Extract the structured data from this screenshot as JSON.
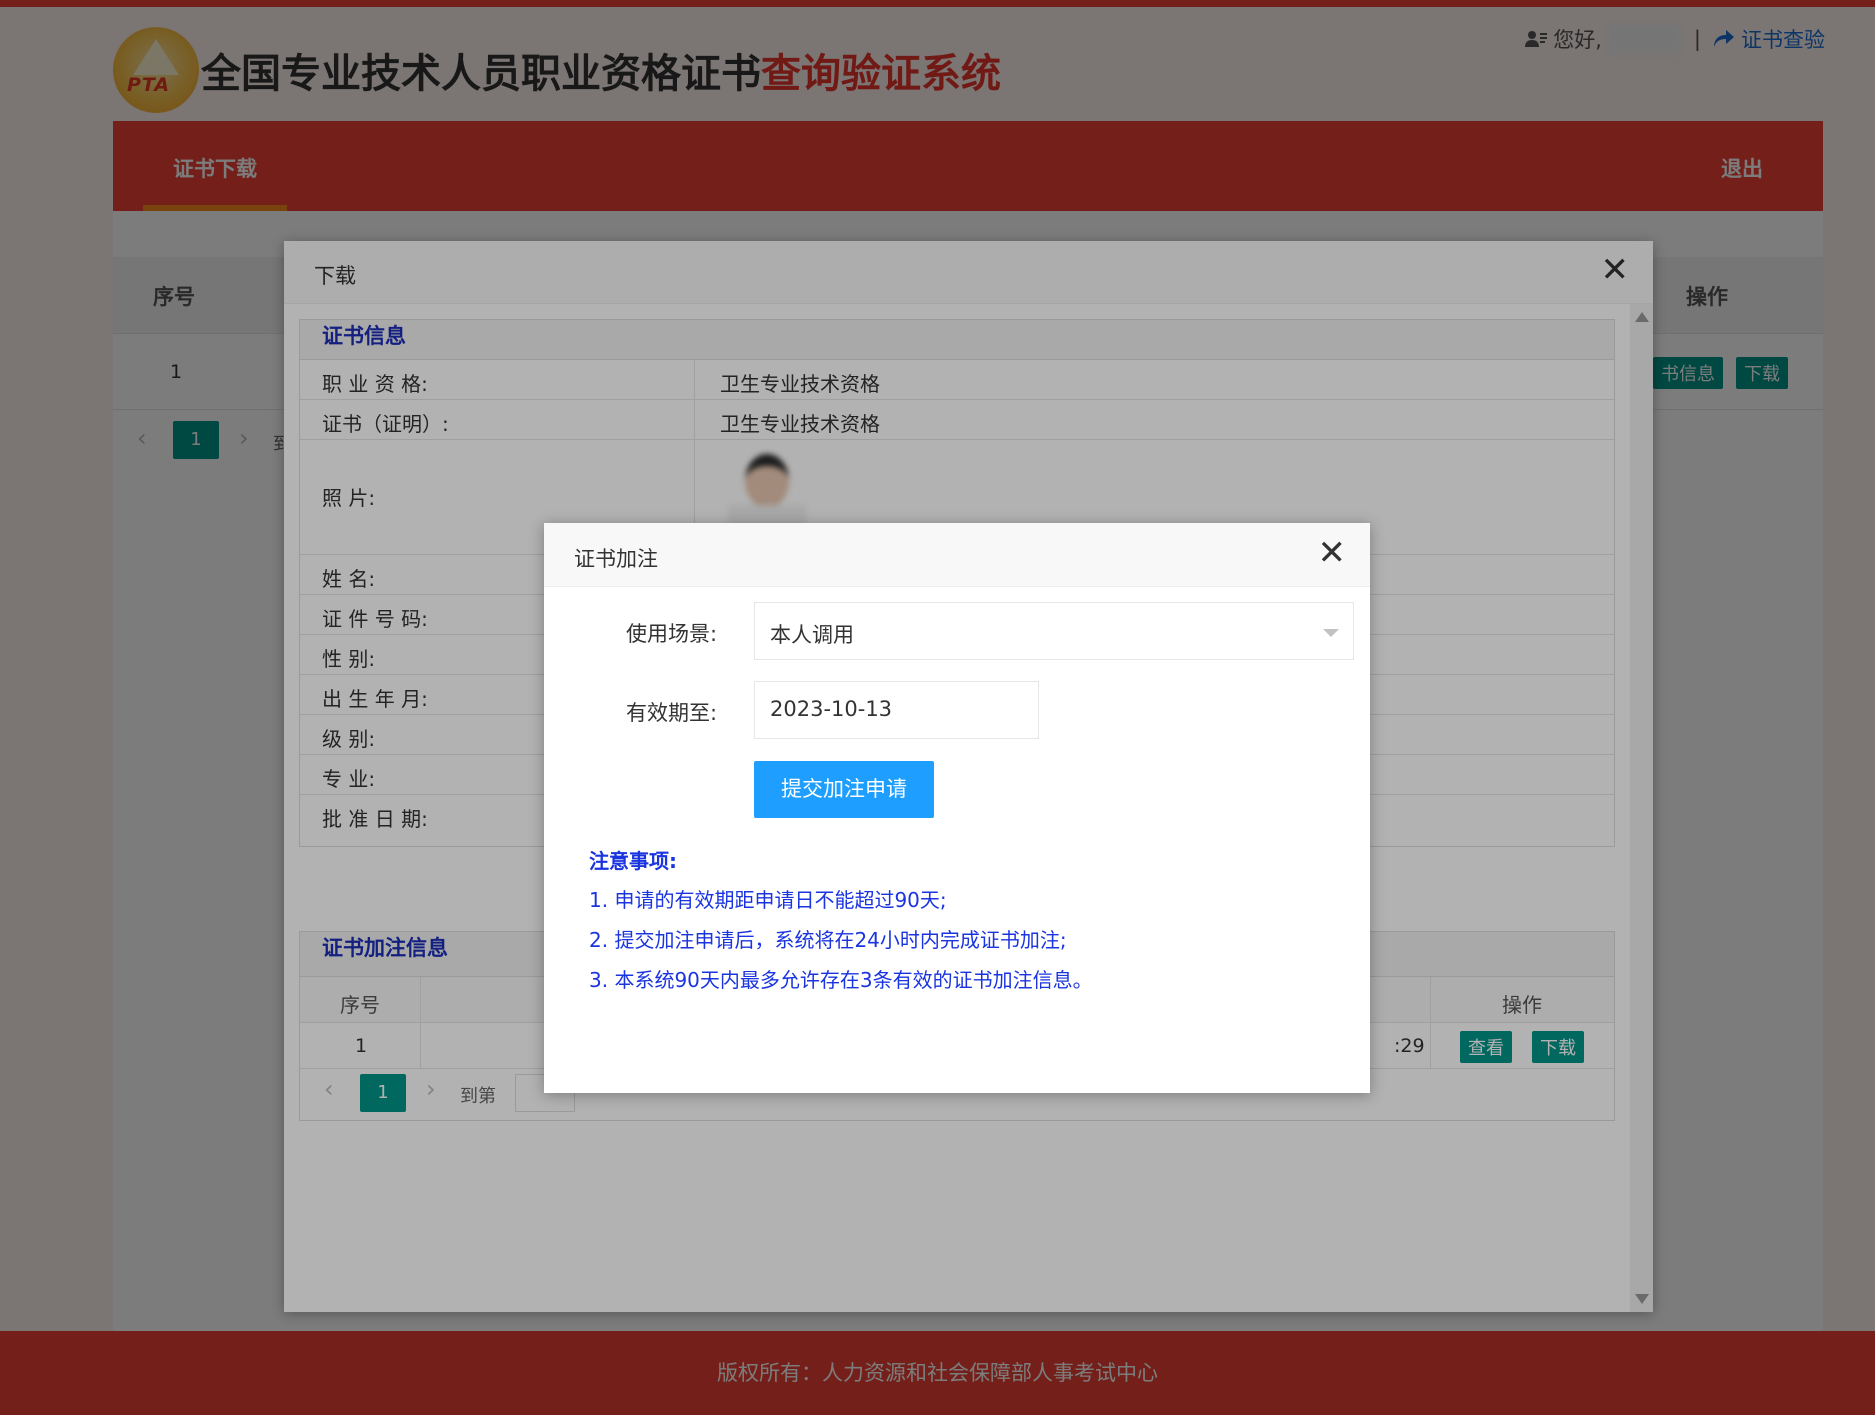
{
  "header": {
    "logo_text": "PTA",
    "title_main": "全国专业技术人员职业资格证书",
    "title_accent": "查询验证系统",
    "greeting": "您好,",
    "separator": "|",
    "verify_link": "证书查验"
  },
  "nav": {
    "tab_active": "证书下载",
    "logout": "退出"
  },
  "bg_table": {
    "col_index": "序号",
    "col_action": "操作",
    "row_index": "1",
    "btn_info": "书信息",
    "btn_download": "下载",
    "page_current": "1",
    "goto_partial": "到"
  },
  "download_dialog": {
    "title": "下载",
    "section_cert": "证书信息",
    "rows": [
      {
        "label": "职 业 资 格:",
        "value": "卫生专业技术资格"
      },
      {
        "label": "证书（证明）:",
        "value": "卫生专业技术资格"
      },
      {
        "label": "照          片:",
        "value": ""
      },
      {
        "label": "姓          名:",
        "value": ""
      },
      {
        "label": "证 件 号 码:",
        "value": ""
      },
      {
        "label": "性          别:",
        "value": ""
      },
      {
        "label": "出 生 年 月:",
        "value": ""
      },
      {
        "label": "级          别:",
        "value": ""
      },
      {
        "label": "专          业:",
        "value": ""
      },
      {
        "label": "批 准 日 期:",
        "value": ""
      }
    ],
    "section_note": "证书加注信息",
    "note_col_index": "序号",
    "note_col_action": "操作",
    "note_row_index": "1",
    "note_row_time_tail": ":29",
    "btn_view": "查看",
    "btn_download": "下载",
    "page_current": "1",
    "goto_label": "到第"
  },
  "annotate_dialog": {
    "title": "证书加注",
    "scene_label": "使用场景:",
    "scene_value": "本人调用",
    "valid_label": "有效期至:",
    "valid_value": "2023-10-13",
    "submit_label": "提交加注申请",
    "notice_title": "注意事项:",
    "notice_items": [
      "1. 申请的有效期距申请日不能超过90天;",
      "2. 提交加注申请后，系统将在24小时内完成证书加注;",
      "3. 本系统90天内最多允许存在3条有效的证书加注信息。"
    ]
  },
  "footer": {
    "copyright": "版权所有：人力资源和社会保障部人事考试中心"
  },
  "colors": {
    "brand_red": "#ee4136",
    "accent_orange": "#f78a1d",
    "teal": "#009688",
    "primary_blue": "#1e9fff",
    "notice_blue": "#1a34e0"
  }
}
